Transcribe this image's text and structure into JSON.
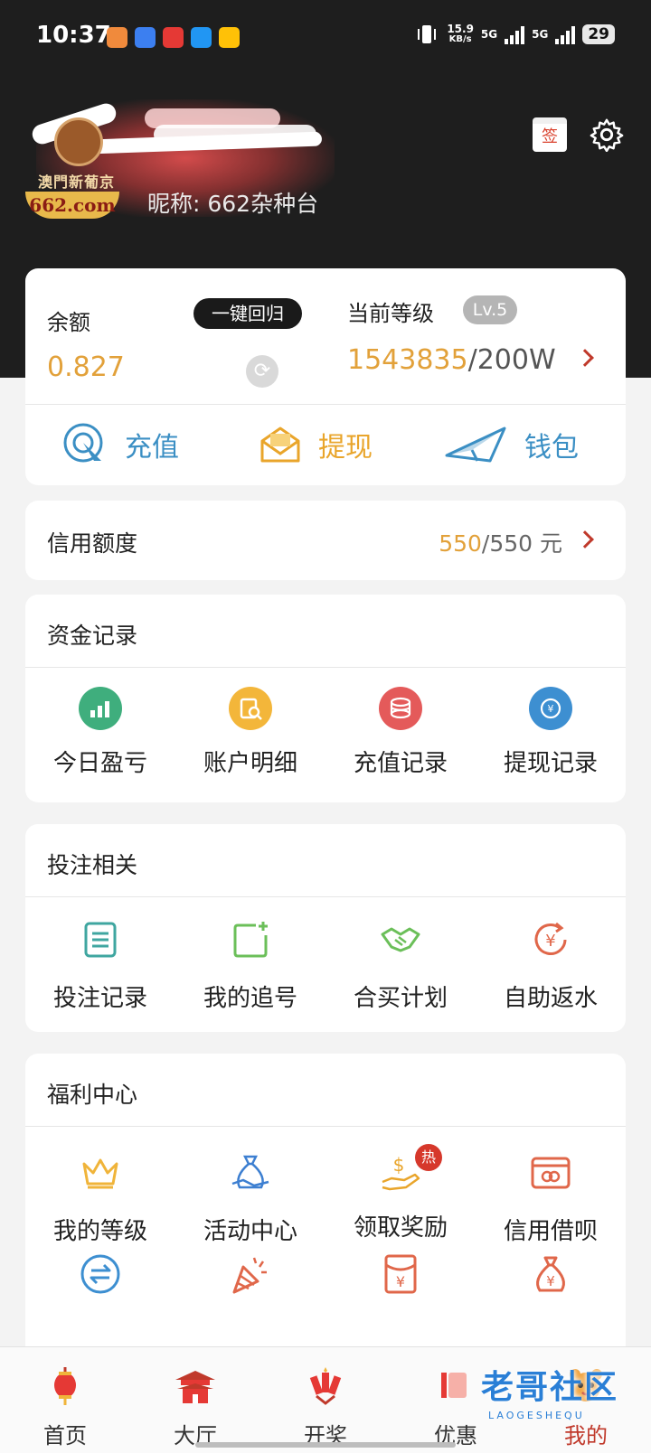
{
  "status": {
    "time": "10:37",
    "net_speed_value": "15.9",
    "net_speed_unit": "KB/s",
    "sim1": "5G",
    "sim2": "5G",
    "battery": "29"
  },
  "profile": {
    "logo_text": "澳門新葡京",
    "logo_badge": "662.com",
    "nickname": "昵称: 662杂种台",
    "sign_label": "签"
  },
  "balance": {
    "label": "余额",
    "value": "0.827",
    "one_click_label": "一键回归",
    "level_label": "当前等级",
    "level_badge": "Lv.5",
    "level_current": "1543835",
    "level_target": "/200W"
  },
  "quick_actions": [
    {
      "label": "充值",
      "icon": "recharge-icon",
      "color": "#3b8fc4"
    },
    {
      "label": "提现",
      "icon": "withdraw-icon",
      "color": "#e9a52b"
    },
    {
      "label": "钱包",
      "icon": "wallet-icon",
      "color": "#3b8fc4"
    }
  ],
  "credit": {
    "label": "信用额度",
    "used": "550",
    "total": "/550 元"
  },
  "fund_records": {
    "title": "资金记录",
    "items": [
      {
        "label": "今日盈亏",
        "icon": "chart-icon",
        "color": "#3fae7d"
      },
      {
        "label": "账户明细",
        "icon": "account-detail-icon",
        "color": "#f3b63a"
      },
      {
        "label": "充值记录",
        "icon": "coins-icon",
        "color": "#e45a5a"
      },
      {
        "label": "提现记录",
        "icon": "withdraw-record-icon",
        "color": "#3d8fd1"
      }
    ]
  },
  "betting": {
    "title": "投注相关",
    "items": [
      {
        "label": "投注记录",
        "icon": "list-icon",
        "color": "#3fa6a0"
      },
      {
        "label": "我的追号",
        "icon": "add-square-icon",
        "color": "#6bbf59"
      },
      {
        "label": "合买计划",
        "icon": "handshake-icon",
        "color": "#6bbf59"
      },
      {
        "label": "自助返水",
        "icon": "yen-refresh-icon",
        "color": "#e0674a"
      }
    ]
  },
  "welfare": {
    "title": "福利中心",
    "items": [
      {
        "label": "我的等级",
        "icon": "crown-icon",
        "color": "#f0b43a"
      },
      {
        "label": "活动中心",
        "icon": "gift-bag-icon",
        "color": "#3d7fd1"
      },
      {
        "label": "领取奖励",
        "icon": "reward-hand-icon",
        "color": "#e9a52b",
        "badge": "热"
      },
      {
        "label": "信用借呗",
        "icon": "card-icon",
        "color": "#e0674a"
      }
    ],
    "row2_icons": [
      {
        "icon": "transfer-icon",
        "color": "#3d8fd1"
      },
      {
        "icon": "party-popper-icon",
        "color": "#e0674a"
      },
      {
        "icon": "yen-envelope-icon",
        "color": "#e0674a"
      },
      {
        "icon": "money-bag-icon",
        "color": "#e0674a"
      }
    ]
  },
  "bottom_nav": [
    {
      "label": "首页",
      "icon": "lantern-icon"
    },
    {
      "label": "大厅",
      "icon": "palace-icon"
    },
    {
      "label": "开奖",
      "icon": "firecracker-icon"
    },
    {
      "label": "优惠",
      "icon": "promo-icon"
    },
    {
      "label": "我的",
      "icon": "tiger-icon",
      "active": true
    }
  ],
  "watermark": {
    "text": "老哥社区",
    "sub": "LAOGESHEQU"
  }
}
